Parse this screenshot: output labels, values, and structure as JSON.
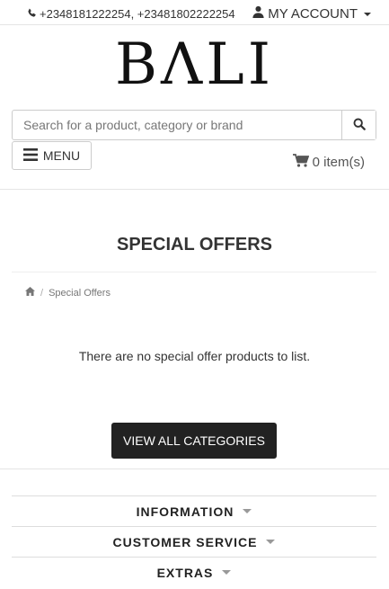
{
  "header": {
    "phone_numbers": "+2348181222254, +23481802222254",
    "account_label": "MY ACCOUNT"
  },
  "logo": {
    "text": "BΛLI"
  },
  "search": {
    "placeholder": "Search for a product, category or brand",
    "value": ""
  },
  "nav": {
    "menu_label": "MENU",
    "cart_label": "0 item(s)"
  },
  "page": {
    "title": "SPECIAL OFFERS",
    "breadcrumb_current": "Special Offers",
    "empty_message": "There are no special offer products to list.",
    "view_all_label": "VIEW ALL CATEGORIES"
  },
  "footer": {
    "sections": [
      "INFORMATION",
      "CUSTOMER SERVICE",
      "EXTRAS"
    ]
  },
  "colors": {
    "button_dark": "#222222",
    "text_main": "#333333",
    "border": "#cccccc"
  }
}
